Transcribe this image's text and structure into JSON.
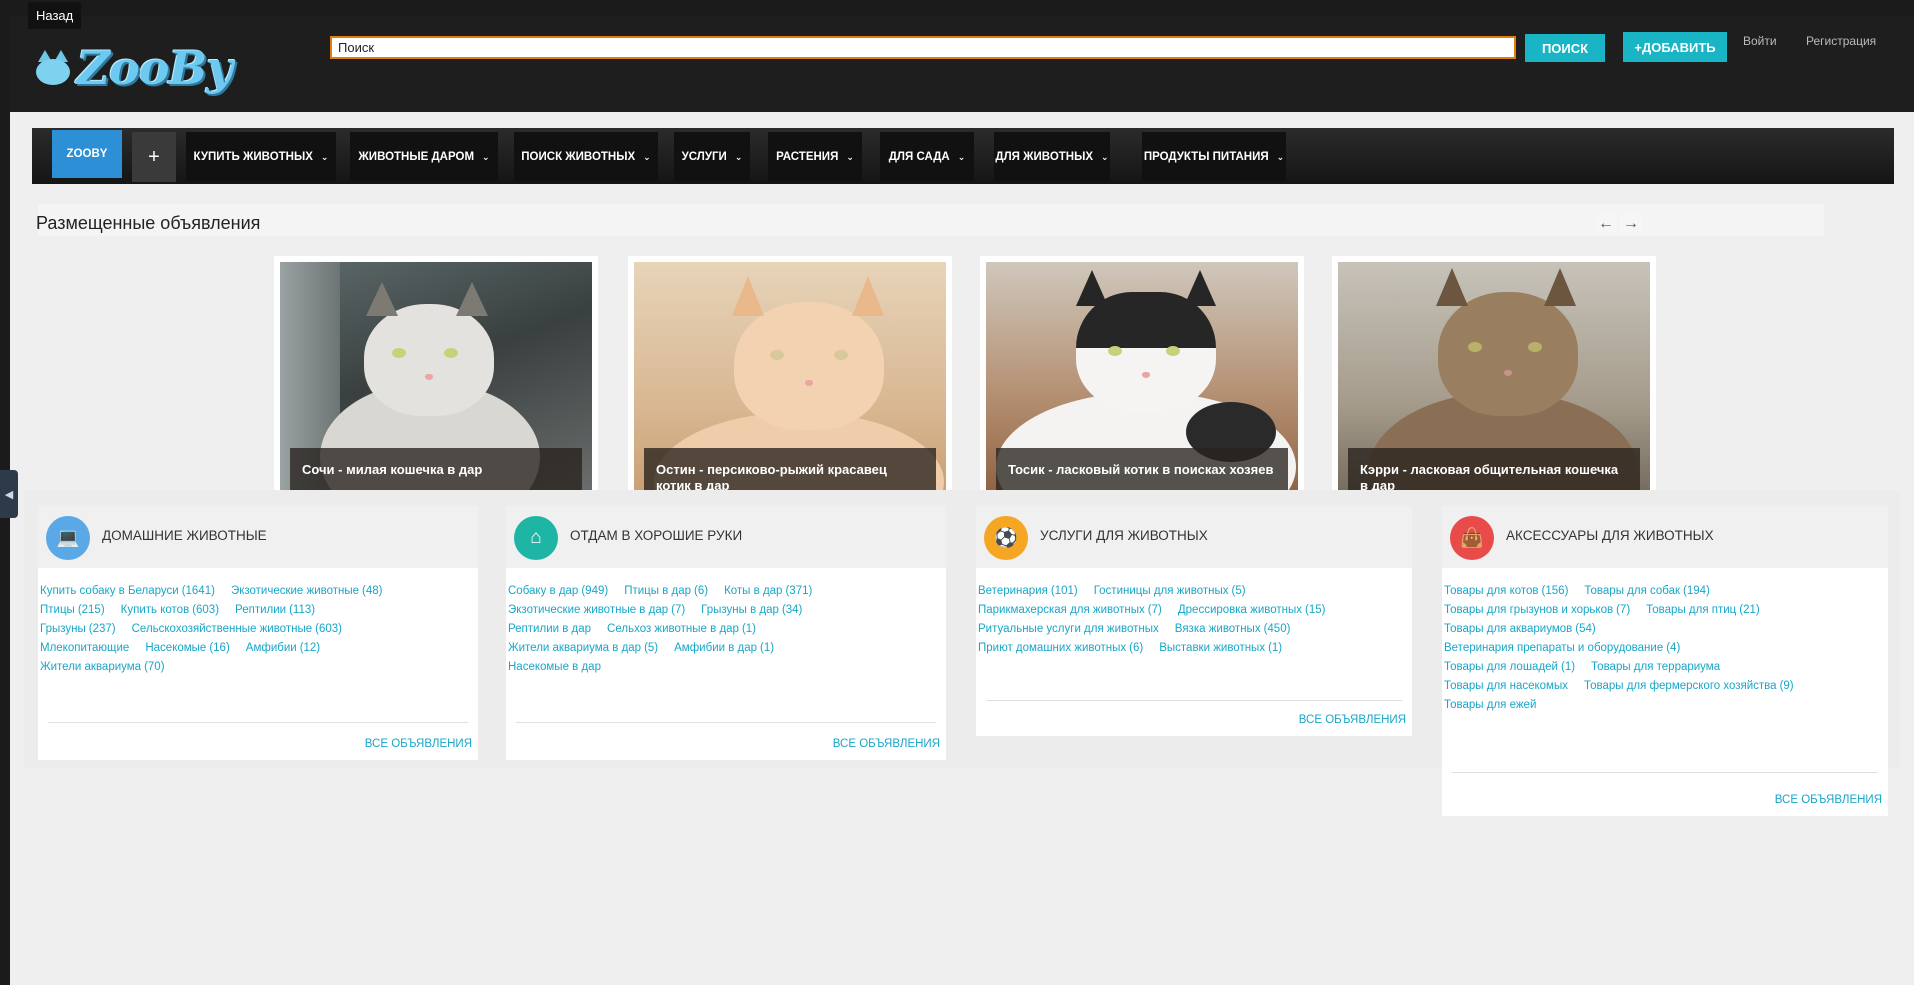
{
  "header": {
    "back_tooltip": "Назад",
    "logo_text": "ZooBy",
    "search_placeholder": "Поиск",
    "search_value": "Поиск",
    "search_button": "ПОИСК",
    "add_button": "+ДОБАВИТЬ",
    "login": "Войти",
    "register": "Регистрация"
  },
  "nav": {
    "home": "ZOOBY",
    "plus": "+",
    "items": [
      "КУПИТЬ ЖИВОТНЫХ",
      "ЖИВОТНЫЕ ДАРОМ",
      "ПОИСК ЖИВОТНЫХ",
      "УСЛУГИ",
      "РАСТЕНИЯ",
      "ДЛЯ САДА",
      "ДЛЯ ЖИВОТНЫХ",
      "ПРОДУКТЫ ПИТАНИЯ"
    ]
  },
  "ads": {
    "title": "Размещенные объявления",
    "prev": "←",
    "next": "→",
    "cards": [
      {
        "caption": "Сочи - милая кошечка в дар"
      },
      {
        "caption": "Остин - персиково-рыжий красавец котик в дар"
      },
      {
        "caption": "Тосик - ласковый котик в поисках хозяев"
      },
      {
        "caption": "Кэрри - ласковая общительная кошечка в дар"
      }
    ]
  },
  "categories": [
    {
      "title": "ДОМАШНИЕ ЖИВОТНЫЕ",
      "icon": "laptop-icon",
      "color": "#5aa8e6",
      "rows": [
        [
          {
            "t": "Купить собаку в Беларуси",
            "c": "(1641)"
          },
          {
            "t": "Экзотические животные",
            "c": "(48)"
          }
        ],
        [
          {
            "t": "Птицы",
            "c": "(215)"
          },
          {
            "t": "Купить котов",
            "c": "(603)"
          },
          {
            "t": "Рептилии",
            "c": "(113)"
          }
        ],
        [
          {
            "t": "Грызуны",
            "c": "(237)"
          },
          {
            "t": "Сельскохозяйственные животные",
            "c": "(603)"
          }
        ],
        [
          {
            "t": "Млекопитающие",
            "c": ""
          },
          {
            "t": "Насекомые",
            "c": "(16)"
          },
          {
            "t": "Амфибии",
            "c": "(12)"
          }
        ],
        [
          {
            "t": "Жители аквариума",
            "c": "(70)"
          }
        ]
      ],
      "all": "ВСЕ ОБЪЯВЛЕНИЯ"
    },
    {
      "title": "ОТДАМ В ХОРОШИЕ РУКИ",
      "icon": "home-icon",
      "color": "#1fb5a5",
      "rows": [
        [
          {
            "t": "Собаку в дар",
            "c": "(949)"
          },
          {
            "t": "Птицы в дар",
            "c": "(6)"
          },
          {
            "t": "Коты в дар",
            "c": "(371)"
          }
        ],
        [
          {
            "t": "Экзотические животные в дар",
            "c": "(7)"
          },
          {
            "t": "Грызуны в дар",
            "c": "(34)"
          }
        ],
        [
          {
            "t": "Рептилии в дар",
            "c": ""
          },
          {
            "t": "Сельхоз животные в дар",
            "c": "(1)"
          }
        ],
        [
          {
            "t": "Жители аквариума в дар",
            "c": "(5)"
          },
          {
            "t": "Амфибии в дар",
            "c": "(1)"
          }
        ],
        [
          {
            "t": "Насекомые в дар",
            "c": ""
          }
        ]
      ],
      "all": "ВСЕ ОБЪЯВЛЕНИЯ"
    },
    {
      "title": "УСЛУГИ ДЛЯ ЖИВОТНЫХ",
      "icon": "ball-icon",
      "color": "#f5a623",
      "rows": [
        [
          {
            "t": "Ветеринария",
            "c": "(101)"
          },
          {
            "t": "Гостиницы для животных",
            "c": "(5)"
          }
        ],
        [
          {
            "t": "Парикмахерская для животных",
            "c": "(7)"
          },
          {
            "t": "Дрессировка животных",
            "c": "(15)"
          }
        ],
        [
          {
            "t": "Ритуальные услуги для животных",
            "c": ""
          },
          {
            "t": "Вязка животных",
            "c": "(450)"
          }
        ],
        [
          {
            "t": "Приют домашних животных",
            "c": "(6)"
          },
          {
            "t": "Выставки животных",
            "c": "(1)"
          }
        ]
      ],
      "all": "ВСЕ ОБЪЯВЛЕНИЯ"
    },
    {
      "title": "АКСЕССУАРЫ ДЛЯ ЖИВОТНЫХ",
      "icon": "bag-icon",
      "color": "#e94b4b",
      "rows": [
        [
          {
            "t": "Товары для котов",
            "c": "(156)"
          },
          {
            "t": "Товары для собак",
            "c": "(194)"
          }
        ],
        [
          {
            "t": "Товары для грызунов и хорьков",
            "c": "(7)"
          },
          {
            "t": "Товары для птиц",
            "c": "(21)"
          }
        ],
        [
          {
            "t": "Товары для аквариумов",
            "c": "(54)"
          }
        ],
        [
          {
            "t": "Ветеринария препараты и оборудование",
            "c": "(4)"
          }
        ],
        [
          {
            "t": "Товары для лошадей",
            "c": "(1)"
          },
          {
            "t": "Товары для террариума",
            "c": ""
          }
        ],
        [
          {
            "t": "Товары для насекомых",
            "c": ""
          },
          {
            "t": "Товары для фермерского хозяйства",
            "c": "(9)"
          }
        ],
        [
          {
            "t": "Товары для ежей",
            "c": ""
          }
        ]
      ],
      "all": "ВСЕ ОБЪЯВЛЕНИЯ"
    }
  ]
}
